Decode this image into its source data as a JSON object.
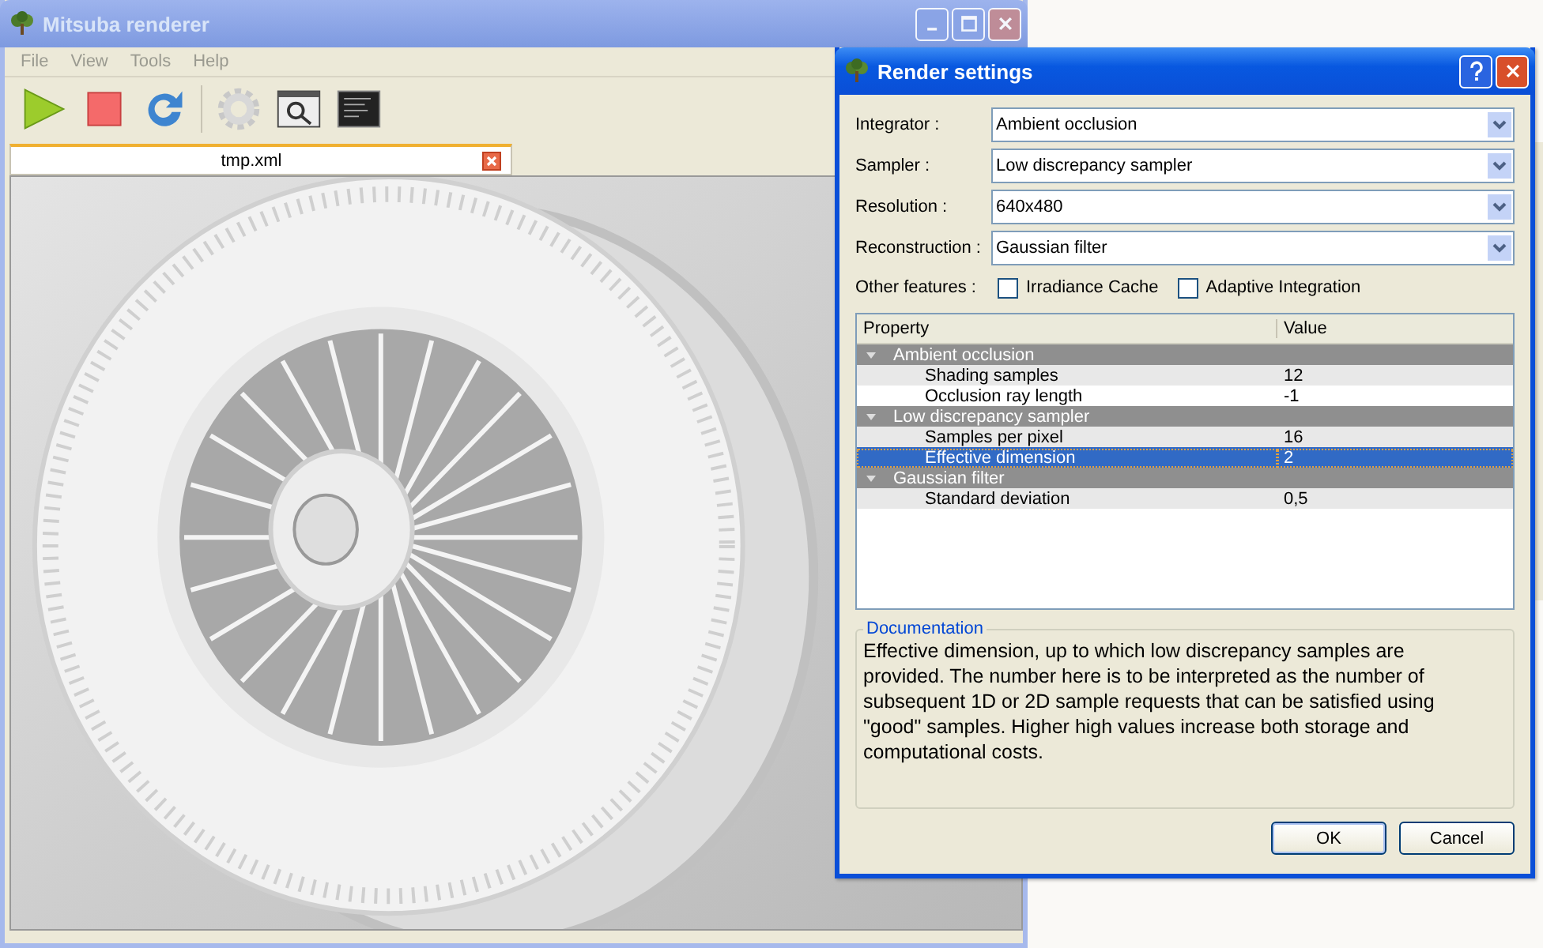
{
  "main_window": {
    "title": "Mitsuba renderer",
    "active": false,
    "menu": [
      "File",
      "View",
      "Tools",
      "Help"
    ],
    "tabs": [
      {
        "label": "tmp.xml",
        "selected": true
      }
    ]
  },
  "dialog": {
    "title": "Render settings",
    "active": true,
    "fields": [
      {
        "label": "Integrator :",
        "value": "Ambient occlusion"
      },
      {
        "label": "Sampler :",
        "value": "Low discrepancy sampler"
      },
      {
        "label": "Resolution :",
        "value": "640x480"
      },
      {
        "label": "Reconstruction :",
        "value": "Gaussian filter"
      }
    ],
    "features_label": "Other features :",
    "features": [
      {
        "label": "Irradiance Cache",
        "checked": false
      },
      {
        "label": "Adaptive Integration",
        "checked": false
      }
    ],
    "properties": {
      "columns": [
        "Property",
        "Value"
      ],
      "groups": [
        {
          "name": "Ambient occlusion",
          "expanded": true,
          "rows": [
            {
              "name": "Shading samples",
              "value": "12",
              "selected": false
            },
            {
              "name": "Occlusion ray length",
              "value": "-1",
              "selected": false
            }
          ]
        },
        {
          "name": "Low discrepancy sampler",
          "expanded": true,
          "rows": [
            {
              "name": "Samples per pixel",
              "value": "16",
              "selected": false
            },
            {
              "name": "Effective dimension",
              "value": "2",
              "selected": true
            }
          ]
        },
        {
          "name": "Gaussian filter",
          "expanded": true,
          "rows": [
            {
              "name": "Standard deviation",
              "value": "0,5",
              "selected": false
            }
          ]
        }
      ]
    },
    "documentation": {
      "title": "Documentation",
      "text": "Effective dimension, up to which low discrepancy samples are provided. The number here is to be interpreted as the number of subsequent 1D or 2D sample requests that can be satisfied using \"good\" samples. Higher high values increase both storage and computational costs."
    },
    "buttons": [
      {
        "label": "OK",
        "default": true
      },
      {
        "label": "Cancel",
        "default": false
      }
    ]
  }
}
